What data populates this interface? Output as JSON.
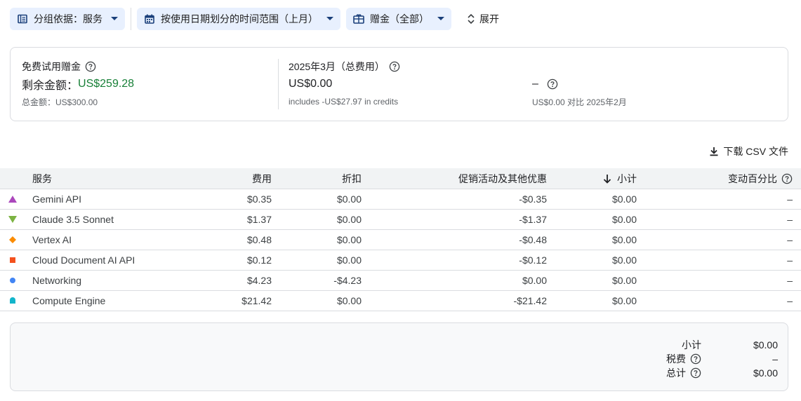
{
  "filters": {
    "group_by": {
      "label": "分组依据：服务",
      "icon": "table-list-icon"
    },
    "date_range": {
      "label": "按使用日期划分的时间范围（上月）",
      "icon": "calendar-icon"
    },
    "credits": {
      "label": "赠金（全部）",
      "icon": "credit-card-icon"
    },
    "expand_label": "展开"
  },
  "summary": {
    "trial": {
      "title": "免费试用赠金",
      "remaining_label": "剩余金额：",
      "remaining_value": "US$259.28",
      "total_text": "总金额：US$300.00"
    },
    "month": {
      "title": "2025年3月（总费用）",
      "value": "US$0.00",
      "note": "includes -US$27.97 in credits"
    },
    "change": {
      "value": "–",
      "note": "US$0.00 对比 2025年2月"
    }
  },
  "download_label": "下载 CSV 文件",
  "table": {
    "headers": {
      "service": "服务",
      "cost": "费用",
      "discount": "折扣",
      "promo": "促销活动及其他优惠",
      "subtotal": "小计",
      "pct_change": "变动百分比"
    },
    "rows": [
      {
        "marker": "triangle-up",
        "color": "#ab47bc",
        "service": "Gemini API",
        "cost": "$0.35",
        "discount": "$0.00",
        "promo": "-$0.35",
        "subtotal": "$0.00",
        "pct": "–"
      },
      {
        "marker": "triangle-down",
        "color": "#7cb342",
        "service": "Claude 3.5 Sonnet",
        "cost": "$1.37",
        "discount": "$0.00",
        "promo": "-$1.37",
        "subtotal": "$0.00",
        "pct": "–"
      },
      {
        "marker": "diamond",
        "color": "#fb8c00",
        "service": "Vertex AI",
        "cost": "$0.48",
        "discount": "$0.00",
        "promo": "-$0.48",
        "subtotal": "$0.00",
        "pct": "–"
      },
      {
        "marker": "square",
        "color": "#f4511e",
        "service": "Cloud Document AI API",
        "cost": "$0.12",
        "discount": "$0.00",
        "promo": "-$0.12",
        "subtotal": "$0.00",
        "pct": "–"
      },
      {
        "marker": "circle",
        "color": "#4285f4",
        "service": "Networking",
        "cost": "$4.23",
        "discount": "-$4.23",
        "promo": "$0.00",
        "subtotal": "$0.00",
        "pct": "–"
      },
      {
        "marker": "rounded-square",
        "color": "#12b5cb",
        "service": "Compute Engine",
        "cost": "$21.42",
        "discount": "$0.00",
        "promo": "-$21.42",
        "subtotal": "$0.00",
        "pct": "–"
      }
    ]
  },
  "totals": {
    "subtotal_label": "小计",
    "subtotal_value": "$0.00",
    "tax_label": "税费",
    "tax_value": "–",
    "total_label": "总计",
    "total_value": "$0.00"
  },
  "colors": {
    "accent": "#1a73e8",
    "chip_bg": "#e8f0fe",
    "positive": "#188038",
    "header_bg": "#f1f3f4"
  }
}
